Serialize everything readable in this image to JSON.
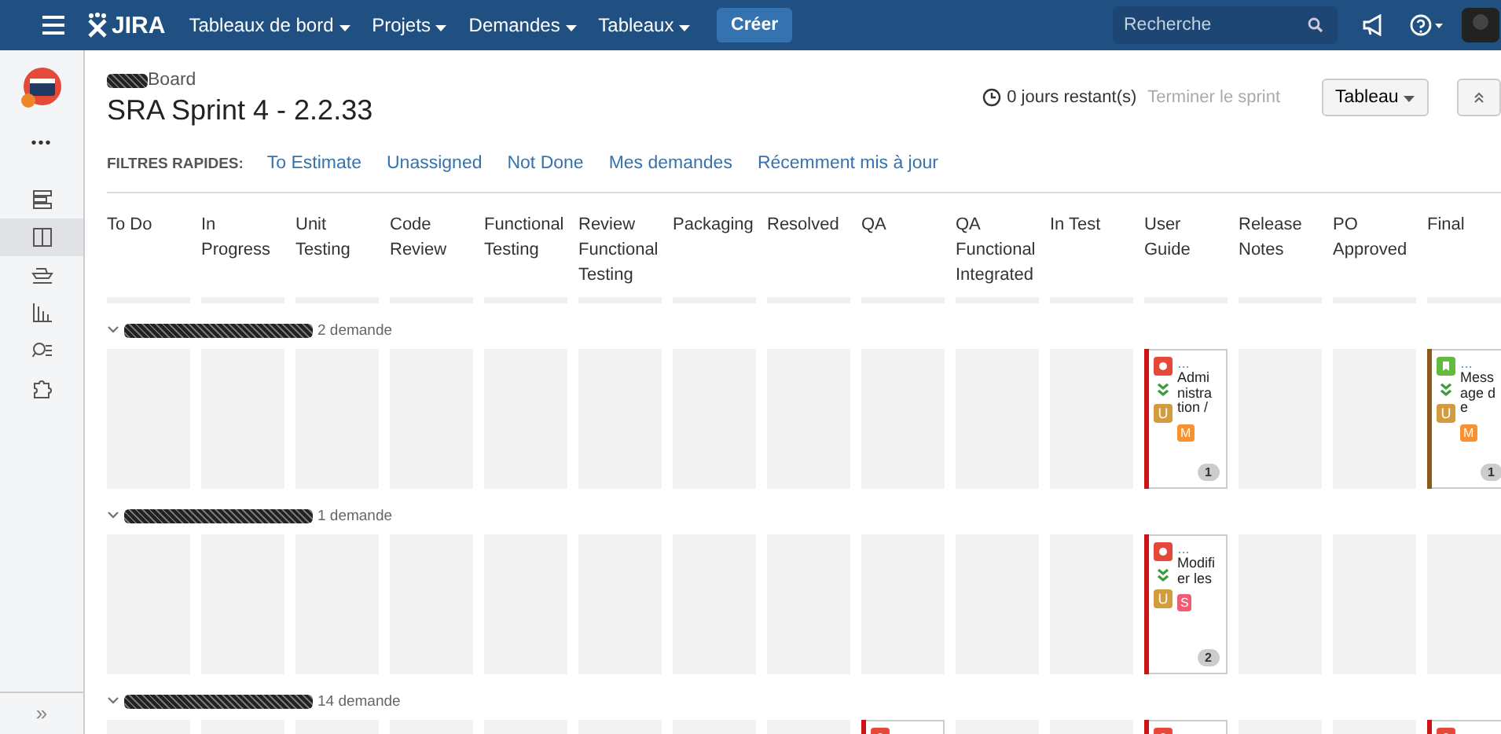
{
  "nav": {
    "logo": "JIRA",
    "menus": [
      {
        "label": "Tableaux de bord"
      },
      {
        "label": "Projets"
      },
      {
        "label": "Demandes"
      },
      {
        "label": "Tableaux"
      }
    ],
    "create": "Créer",
    "search": {
      "placeholder": "Recherche"
    }
  },
  "sidebar": {
    "more": "•••",
    "items": [
      {
        "kind": "backlog",
        "selected": false
      },
      {
        "kind": "board",
        "selected": true
      },
      {
        "kind": "releases",
        "selected": false
      },
      {
        "kind": "reports",
        "selected": false
      },
      {
        "kind": "search",
        "selected": false
      },
      {
        "kind": "addon",
        "selected": false
      }
    ],
    "expand": "»"
  },
  "header": {
    "board": "Board",
    "title": "SRA Sprint 4 - 2.2.33",
    "remaining": "0 jours restant(s)",
    "complete": "Terminer le sprint",
    "view": "Tableau"
  },
  "quick_filters": {
    "label": "FILTRES RAPIDES:",
    "filters": [
      "To Estimate",
      "Unassigned",
      "Not Done",
      "Mes demandes",
      "Récemment mis à jour"
    ]
  },
  "columns": [
    "To Do",
    "In Progress",
    "Unit Testing",
    "Code Review",
    "Functional Testing",
    "Review Functional Testing",
    "Packaging",
    "Resolved",
    "QA",
    "QA Functional Integrated",
    "In Test",
    "User Guide",
    "Release Notes",
    "PO Approved",
    "Final"
  ],
  "swimlanes": [
    {
      "summary": "2 demande",
      "expanded": true,
      "cells": [
        null,
        null,
        null,
        null,
        null,
        null,
        null,
        null,
        null,
        null,
        null,
        {
          "kind": "bug",
          "key": "…",
          "summary": "Administration /",
          "assignee": "U",
          "tag": {
            "label": "M",
            "color": "#f79232"
          },
          "count": "1",
          "color": "#cc1414"
        },
        null,
        null,
        {
          "kind": "story",
          "key": "…",
          "summary": "Message de",
          "assignee": "U",
          "tag": {
            "label": "M",
            "color": "#f79232"
          },
          "count": "1",
          "color": "#8b5a1b"
        }
      ]
    },
    {
      "summary": "1 demande",
      "expanded": true,
      "cells": [
        null,
        null,
        null,
        null,
        null,
        null,
        null,
        null,
        null,
        null,
        null,
        {
          "kind": "bug",
          "key": "…",
          "summary": "Modifier les",
          "assignee": "U",
          "tag": {
            "label": "S",
            "color": "#f15c75"
          },
          "count": "2",
          "color": "#cc1414"
        },
        null,
        null,
        null
      ]
    },
    {
      "summary": "14 demande",
      "expanded": true,
      "cells": [
        null,
        null,
        null,
        null,
        null,
        null,
        null,
        null,
        {
          "kind": "bug",
          "color": "#cc1414"
        },
        null,
        null,
        {
          "kind": "bug",
          "color": "#cc1414"
        },
        null,
        null,
        {
          "kind": "bug",
          "color": "#cc1414"
        }
      ]
    }
  ]
}
